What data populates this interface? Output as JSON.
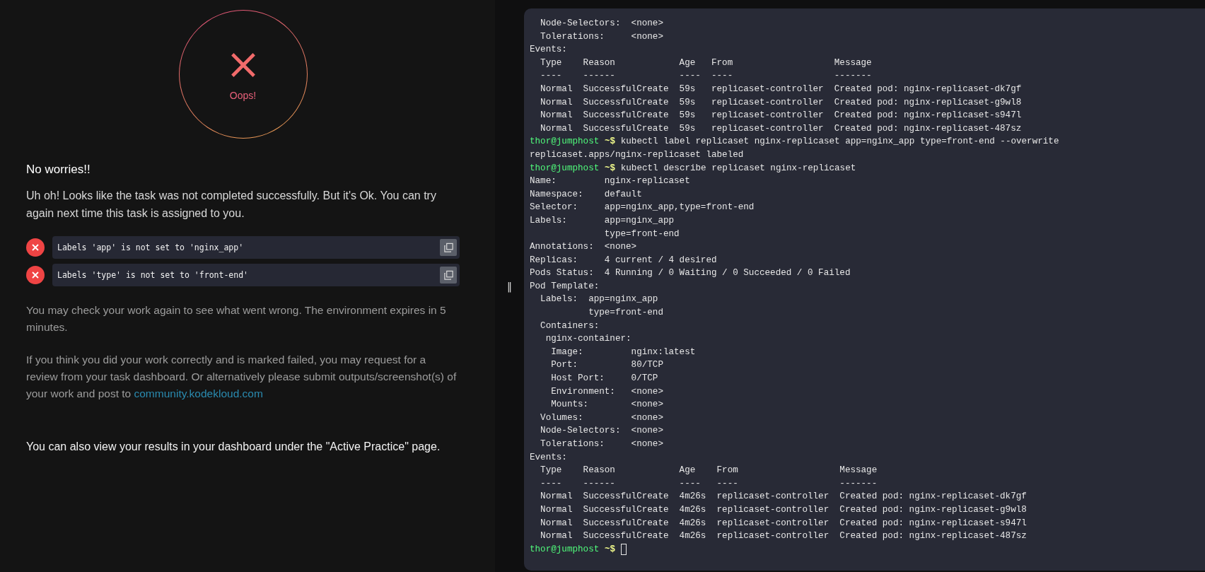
{
  "result": {
    "status_label": "Oops!",
    "heading": "No worries!!",
    "message": "Uh oh! Looks like the task was not completed successfully. But it's Ok. You can try again next time this task is assigned to you.",
    "checks": [
      {
        "text": "Labels 'app' is not set to 'nginx_app'",
        "passed": false
      },
      {
        "text": "Labels 'type' is not set to 'front-end'",
        "passed": false
      }
    ],
    "note_check": "You may check your work again to see what went wrong. The environment expires in 5 minutes.",
    "note_review": "If you think you did your work correctly and is marked failed, you may request for a review from your task dashboard. Or alternatively please submit outputs/screenshot(s) of your work and post to",
    "community_link": "community.kodekloud.com",
    "note_dashboard": "You can also view your results in your dashboard under the \"Active Practice\" page."
  },
  "splitter": {
    "handle": "‖"
  },
  "terminal": {
    "lines": [
      {
        "kind": "output",
        "text": "  Node-Selectors:  <none>"
      },
      {
        "kind": "output",
        "text": "  Tolerations:     <none>"
      },
      {
        "kind": "output",
        "text": "Events:"
      },
      {
        "kind": "output",
        "text": "  Type    Reason            Age   From                   Message"
      },
      {
        "kind": "output",
        "text": "  ----    ------            ----  ----                   -------"
      },
      {
        "kind": "output",
        "text": "  Normal  SuccessfulCreate  59s   replicaset-controller  Created pod: nginx-replicaset-dk7gf"
      },
      {
        "kind": "output",
        "text": "  Normal  SuccessfulCreate  59s   replicaset-controller  Created pod: nginx-replicaset-g9wl8"
      },
      {
        "kind": "output",
        "text": "  Normal  SuccessfulCreate  59s   replicaset-controller  Created pod: nginx-replicaset-s947l"
      },
      {
        "kind": "output",
        "text": "  Normal  SuccessfulCreate  59s   replicaset-controller  Created pod: nginx-replicaset-487sz"
      },
      {
        "kind": "prompt",
        "user": "thor@jumphost",
        "path": "~$",
        "command": "kubectl label replicaset nginx-replicaset app=nginx_app type=front-end --overwrite",
        "cursor": false
      },
      {
        "kind": "output",
        "text": "replicaset.apps/nginx-replicaset labeled"
      },
      {
        "kind": "prompt",
        "user": "thor@jumphost",
        "path": "~$",
        "command": "kubectl describe replicaset nginx-replicaset",
        "cursor": false
      },
      {
        "kind": "output",
        "text": "Name:         nginx-replicaset"
      },
      {
        "kind": "output",
        "text": "Namespace:    default"
      },
      {
        "kind": "output",
        "text": "Selector:     app=nginx_app,type=front-end"
      },
      {
        "kind": "output",
        "text": "Labels:       app=nginx_app"
      },
      {
        "kind": "output",
        "text": "              type=front-end"
      },
      {
        "kind": "output",
        "text": "Annotations:  <none>"
      },
      {
        "kind": "output",
        "text": "Replicas:     4 current / 4 desired"
      },
      {
        "kind": "output",
        "text": "Pods Status:  4 Running / 0 Waiting / 0 Succeeded / 0 Failed"
      },
      {
        "kind": "output",
        "text": "Pod Template:"
      },
      {
        "kind": "output",
        "text": "  Labels:  app=nginx_app"
      },
      {
        "kind": "output",
        "text": "           type=front-end"
      },
      {
        "kind": "output",
        "text": "  Containers:"
      },
      {
        "kind": "output",
        "text": "   nginx-container:"
      },
      {
        "kind": "output",
        "text": "    Image:         nginx:latest"
      },
      {
        "kind": "output",
        "text": "    Port:          80/TCP"
      },
      {
        "kind": "output",
        "text": "    Host Port:     0/TCP"
      },
      {
        "kind": "output",
        "text": "    Environment:   <none>"
      },
      {
        "kind": "output",
        "text": "    Mounts:        <none>"
      },
      {
        "kind": "output",
        "text": "  Volumes:         <none>"
      },
      {
        "kind": "output",
        "text": "  Node-Selectors:  <none>"
      },
      {
        "kind": "output",
        "text": "  Tolerations:     <none>"
      },
      {
        "kind": "output",
        "text": "Events:"
      },
      {
        "kind": "output",
        "text": "  Type    Reason            Age    From                   Message"
      },
      {
        "kind": "output",
        "text": "  ----    ------            ----   ----                   -------"
      },
      {
        "kind": "output",
        "text": "  Normal  SuccessfulCreate  4m26s  replicaset-controller  Created pod: nginx-replicaset-dk7gf"
      },
      {
        "kind": "output",
        "text": "  Normal  SuccessfulCreate  4m26s  replicaset-controller  Created pod: nginx-replicaset-g9wl8"
      },
      {
        "kind": "output",
        "text": "  Normal  SuccessfulCreate  4m26s  replicaset-controller  Created pod: nginx-replicaset-s947l"
      },
      {
        "kind": "output",
        "text": "  Normal  SuccessfulCreate  4m26s  replicaset-controller  Created pod: nginx-replicaset-487sz"
      },
      {
        "kind": "prompt",
        "user": "thor@jumphost",
        "path": "~$",
        "cursor": true
      }
    ]
  }
}
